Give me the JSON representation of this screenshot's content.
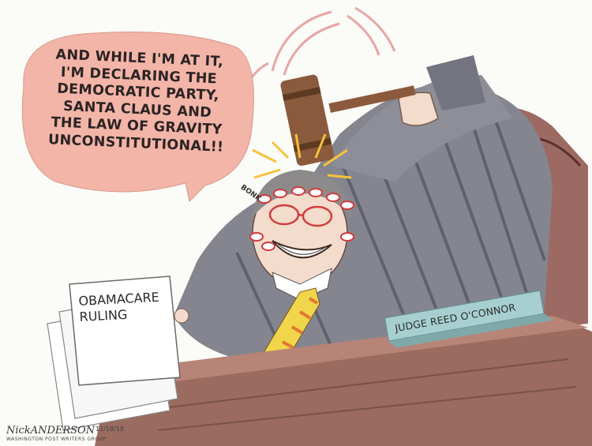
{
  "speech_bubble": {
    "lines": [
      "AND WHILE I'M AT IT,",
      "I'M DECLARING THE",
      "DEMOCRATIC PARTY,",
      "SANTA CLAUS AND",
      "THE LAW OF GRAVITY",
      "UNCONSTITUTIONAL!!"
    ],
    "color": "#f3b5a8"
  },
  "sound_effect": "BONK",
  "document": {
    "lines": [
      "OBAMACARE",
      "RULING"
    ]
  },
  "nameplate": {
    "text": "JUDGE REED O'CONNOR",
    "color": "#a7cfcf"
  },
  "signature": {
    "name": "NickANDERSON",
    "date": "12/18/18",
    "syndicate": "WASHINGTON POST WRITERS GROUP"
  },
  "colors": {
    "robe": "#7b7b86",
    "tie_stripe": "#e07a35",
    "tie_base": "#f1d54a",
    "desk": "#9b6b60",
    "chair": "#8b5048"
  }
}
